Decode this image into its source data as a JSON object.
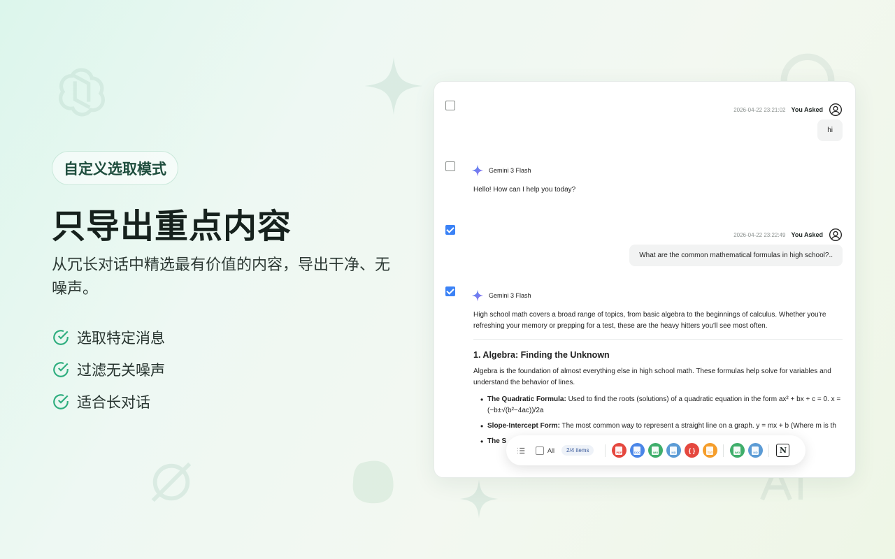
{
  "hero": {
    "badge": "自定义选取模式",
    "title": "只导出重点内容",
    "subtitle": "从冗长对话中精选最有价值的内容，导出干净、无噪声。",
    "features": [
      "选取特定消息",
      "过滤无关噪声",
      "适合长对话"
    ]
  },
  "chat": {
    "messages": [
      {
        "role": "user",
        "checked": false,
        "timestamp": "2026-04-22 23:21:02",
        "label": "You Asked",
        "text": "hi"
      },
      {
        "role": "model",
        "checked": false,
        "model": "Gemini 3 Flash",
        "text": "Hello! How can I help you today?"
      },
      {
        "role": "user",
        "checked": true,
        "timestamp": "2026-04-22 23:22:49",
        "label": "You Asked",
        "text": "What are the common mathematical formulas in high school?.."
      },
      {
        "role": "model",
        "checked": true,
        "model": "Gemini 3 Flash"
      }
    ],
    "answer": {
      "intro": "High school math covers a broad range of topics, from basic algebra to the beginnings of calculus. Whether you're refreshing your memory or prepping for a test, these are the heavy hitters you'll see most often.",
      "section_title": "1. Algebra: Finding the Unknown",
      "section_text": "Algebra is the foundation of almost everything else in high school math. These formulas help solve for variables and understand the behavior of lines.",
      "bullets": [
        {
          "term": "The Quadratic Formula:",
          "text": "Used to find the roots (solutions) of a quadratic equation in the form ax² + bx + c = 0. x = (−b±√(b²−4ac))/2a"
        },
        {
          "term": "Slope-Intercept Form:",
          "text": "The most common way to represent a straight line on a graph. y = mx + b (Where m is th"
        },
        {
          "term": "The S",
          "text": ""
        }
      ]
    }
  },
  "toolbar": {
    "all_label": "All",
    "count_label": "2/4 items",
    "formats": [
      {
        "name": "pdf-icon",
        "label": "PDF",
        "color": "#e5483f"
      },
      {
        "name": "docx-icon",
        "label": "DOC",
        "color": "#4a86e8"
      },
      {
        "name": "image-icon",
        "label": "IMG",
        "color": "#3fae6b"
      },
      {
        "name": "markdown-icon",
        "label": "MD",
        "color": "#5b9bd5"
      },
      {
        "name": "json-icon",
        "label": "{ }",
        "color": "#e5483f"
      },
      {
        "name": "txt-icon",
        "label": "TXT",
        "color": "#f59e2c"
      },
      {
        "name": "sheet-icon",
        "label": "IMG",
        "color": "#3fae6b"
      },
      {
        "name": "md-export-icon",
        "label": "MD",
        "color": "#5b9bd5"
      }
    ],
    "notion_label": "N"
  }
}
